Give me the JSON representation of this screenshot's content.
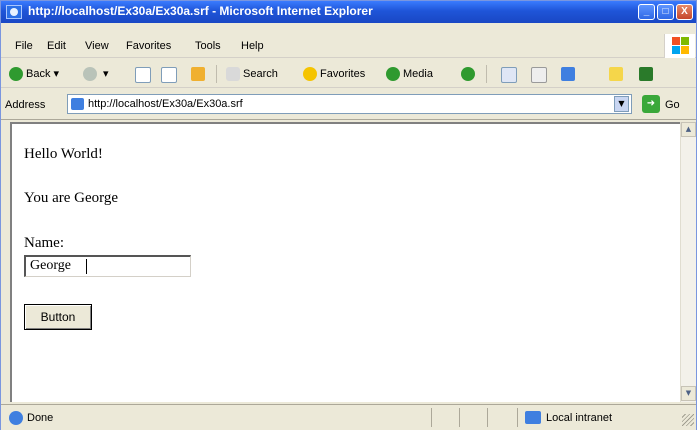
{
  "window": {
    "title": "http://localhost/Ex30a/Ex30a.srf - Microsoft Internet Explorer",
    "controls": {
      "minimize": "_",
      "maximize": "□",
      "close": "X"
    }
  },
  "menu": [
    "File",
    "Edit",
    "View",
    "Favorites",
    "Tools",
    "Help"
  ],
  "toolbar": {
    "back": "Back",
    "search": "Search",
    "favorites": "Favorites",
    "media": "Media"
  },
  "address": {
    "label": "Address",
    "url": "http://localhost/Ex30a/Ex30a.srf",
    "go": "Go"
  },
  "page": {
    "greeting": "Hello World!",
    "you_are": "You are George",
    "name_label": "Name:",
    "name_value": "George",
    "button_label": "Button"
  },
  "status": {
    "text": "Done",
    "zone": "Local intranet"
  },
  "colors": {
    "titlebar": "#1f55d8",
    "chrome": "#ece9d8",
    "content_bg": "#ffffff"
  }
}
